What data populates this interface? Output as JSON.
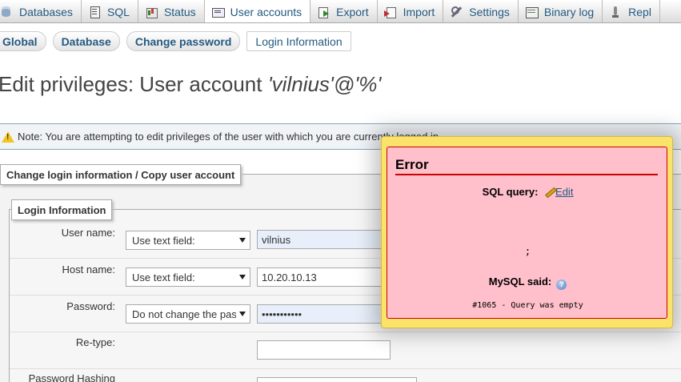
{
  "topnav": {
    "tabs": [
      {
        "label": "Databases",
        "icon": "database-icon"
      },
      {
        "label": "SQL",
        "icon": "sql-icon"
      },
      {
        "label": "Status",
        "icon": "status-icon"
      },
      {
        "label": "User accounts",
        "icon": "user-accounts-icon",
        "active": true
      },
      {
        "label": "Export",
        "icon": "export-icon"
      },
      {
        "label": "Import",
        "icon": "import-icon"
      },
      {
        "label": "Settings",
        "icon": "wrench-icon"
      },
      {
        "label": "Binary log",
        "icon": "binary-log-icon"
      },
      {
        "label": "Repl",
        "icon": "replication-icon"
      }
    ]
  },
  "subtabs": [
    {
      "label": "Global"
    },
    {
      "label": "Database"
    },
    {
      "label": "Change password"
    },
    {
      "label": "Login Information",
      "active": true
    }
  ],
  "page": {
    "title_prefix": "Edit privileges: User account ",
    "title_account": "'vilnius'@'%'"
  },
  "notice": {
    "text": "Note: You are attempting to edit privileges of the user with which you are currently logged in."
  },
  "main_fieldset": {
    "legend": "Change login information / Copy user account"
  },
  "login_info": {
    "legend": "Login Information",
    "user_name": {
      "label": "User name:",
      "select": "Use text field:",
      "value": "vilnius"
    },
    "host_name": {
      "label": "Host name:",
      "select": "Use text field:",
      "value": "10.20.10.13"
    },
    "password": {
      "label": "Password:",
      "select": "Do not change the password",
      "value": "•••••••••••"
    },
    "retype": {
      "label": "Re-type:",
      "value": ""
    },
    "hashing": {
      "label": "Password Hashing"
    }
  },
  "error": {
    "title": "Error",
    "sql_query_label": "SQL query:",
    "edit_label": "Edit",
    "query": ";",
    "mysql_said_label": "MySQL said:",
    "message": "#1065 - Query was empty"
  },
  "colors": {
    "link": "#235a81",
    "error_bg": "#ffc0cb",
    "error_border": "#cc0000",
    "popup_bg": "#fbe36b"
  }
}
